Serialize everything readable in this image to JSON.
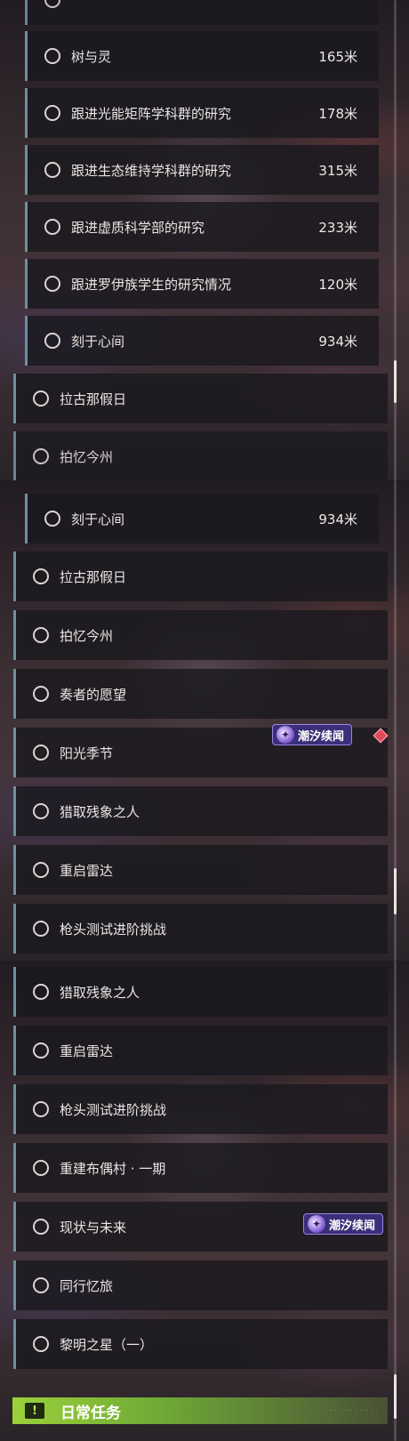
{
  "panel1": {
    "rows": [
      {
        "label": "",
        "distance": ""
      },
      {
        "label": "树与灵",
        "distance": "165米"
      },
      {
        "label": "跟进光能矩阵学科群的研究",
        "distance": "178米"
      },
      {
        "label": "跟进生态维持学科群的研究",
        "distance": "315米"
      },
      {
        "label": "跟进虚质科学部的研究",
        "distance": "233米"
      },
      {
        "label": "跟进罗伊族学生的研究情况",
        "distance": "120米"
      },
      {
        "label": "刻于心间",
        "distance": "934米"
      },
      {
        "label": "拉古那假日",
        "distance": ""
      },
      {
        "label": "拍忆今州",
        "distance": ""
      }
    ]
  },
  "panel2": {
    "rows": [
      {
        "label": "刻于心间",
        "distance": "934米"
      },
      {
        "label": "拉古那假日"
      },
      {
        "label": "拍忆今州"
      },
      {
        "label": "奏者的愿望"
      },
      {
        "label": "阳光季节"
      },
      {
        "label": "猎取残象之人"
      },
      {
        "label": "重启雷达"
      },
      {
        "label": "枪头测试进阶挑战"
      }
    ],
    "event_badge": "潮汐续闻"
  },
  "panel3": {
    "rows": [
      {
        "label": "猎取残象之人"
      },
      {
        "label": "重启雷达"
      },
      {
        "label": "枪头测试进阶挑战"
      },
      {
        "label": "重建布偶村 · 一期"
      },
      {
        "label": "现状与未来"
      },
      {
        "label": "同行忆旅"
      },
      {
        "label": "黎明之星（一）"
      }
    ],
    "event_badge": "潮汐续闻",
    "daily_section": {
      "icon": "!",
      "title": "日常任务"
    }
  },
  "colors": {
    "accent_bar": "#6f8fa0",
    "event_badge_bg": "#3a2f78",
    "daily_green": "#9bd13a",
    "alert_diamond": "#e04a5a"
  },
  "icons": {
    "radio": "radio-circle-icon",
    "event": "tidal-event-icon",
    "daily": "exclamation-icon",
    "alert": "red-diamond-icon"
  }
}
